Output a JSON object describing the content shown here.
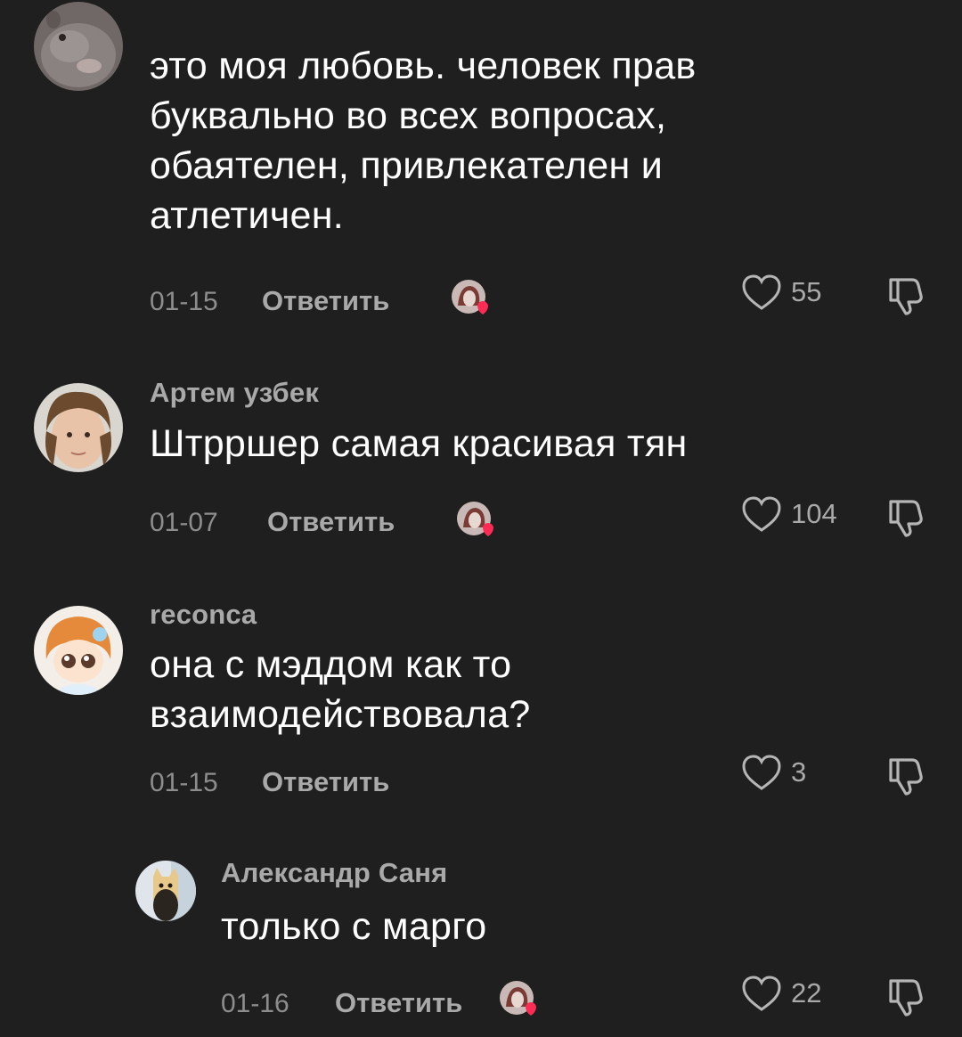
{
  "comments": [
    {
      "username": "",
      "text": "это моя любовь. человек прав буквально во всех вопросах, обаятелен, привлекателен и атлетичен.",
      "date": "01-15",
      "reply_label": "Ответить",
      "likes": "55",
      "has_creator_like": true,
      "avatar_icon": "wombat-avatar"
    },
    {
      "username": "Артем узбек",
      "text": "Штрршер самая красивая тян",
      "date": "01-07",
      "reply_label": "Ответить",
      "likes": "104",
      "has_creator_like": true,
      "avatar_icon": "person-avatar"
    },
    {
      "username": "reconca",
      "text": "она с мэддом как то взаимодействовала?",
      "date": "01-15",
      "reply_label": "Ответить",
      "likes": "3",
      "has_creator_like": false,
      "avatar_icon": "anime-girl-avatar"
    },
    {
      "username": "Александр Саня",
      "text": "только с марго",
      "date": "01-16",
      "reply_label": "Ответить",
      "likes": "22",
      "has_creator_like": true,
      "avatar_icon": "cat-avatar",
      "is_reply": true
    }
  ],
  "colors": {
    "background": "#1f1f1f",
    "text": "#ffffff",
    "secondary": "#a9a9a9",
    "date": "#8d8d8d",
    "heart_badge": "#fe2c55"
  }
}
